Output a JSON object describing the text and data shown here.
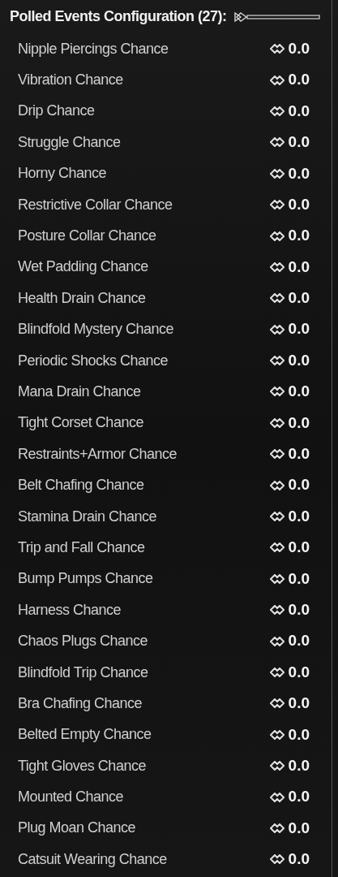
{
  "header": {
    "title": "Polled Events Configuration (27):"
  },
  "options": [
    {
      "label": "Nipple Piercings Chance",
      "value": "0.0"
    },
    {
      "label": "Vibration Chance",
      "value": "0.0"
    },
    {
      "label": "Drip Chance",
      "value": "0.0"
    },
    {
      "label": "Struggle Chance",
      "value": "0.0"
    },
    {
      "label": "Horny Chance",
      "value": "0.0"
    },
    {
      "label": "Restrictive Collar Chance",
      "value": "0.0"
    },
    {
      "label": "Posture Collar Chance",
      "value": "0.0"
    },
    {
      "label": "Wet Padding Chance",
      "value": "0.0"
    },
    {
      "label": "Health Drain Chance",
      "value": "0.0"
    },
    {
      "label": "Blindfold Mystery Chance",
      "value": "0.0"
    },
    {
      "label": "Periodic Shocks Chance",
      "value": "0.0"
    },
    {
      "label": "Mana Drain Chance",
      "value": "0.0"
    },
    {
      "label": "Tight Corset Chance",
      "value": "0.0"
    },
    {
      "label": "Restraints+Armor Chance",
      "value": "0.0"
    },
    {
      "label": "Belt Chafing Chance",
      "value": "0.0"
    },
    {
      "label": "Stamina Drain Chance",
      "value": "0.0"
    },
    {
      "label": "Trip and Fall Chance",
      "value": "0.0"
    },
    {
      "label": "Bump Pumps Chance",
      "value": "0.0"
    },
    {
      "label": "Harness Chance",
      "value": "0.0"
    },
    {
      "label": "Chaos Plugs Chance",
      "value": "0.0"
    },
    {
      "label": "Blindfold Trip Chance",
      "value": "0.0"
    },
    {
      "label": "Bra Chafing Chance",
      "value": "0.0"
    },
    {
      "label": "Belted Empty Chance",
      "value": "0.0"
    },
    {
      "label": "Tight Gloves Chance",
      "value": "0.0"
    },
    {
      "label": "Mounted Chance",
      "value": "0.0"
    },
    {
      "label": "Plug Moan Chance",
      "value": "0.0"
    },
    {
      "label": "Catsuit Wearing Chance",
      "value": "0.0"
    }
  ]
}
